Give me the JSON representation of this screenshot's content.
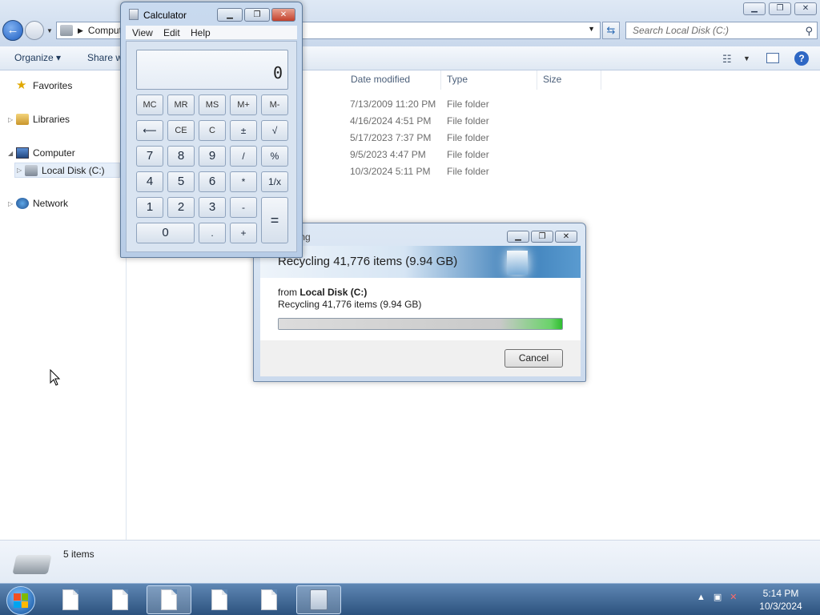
{
  "explorer": {
    "address": {
      "crumb": "Computer"
    },
    "search_placeholder": "Search Local Disk (C:)",
    "toolbar": {
      "organize": "Organize",
      "share": "Share with"
    },
    "nav": {
      "favorites": "Favorites",
      "libraries": "Libraries",
      "computer": "Computer",
      "local_disk": "Local Disk (C:)",
      "network": "Network"
    },
    "columns": {
      "date_modified": "Date modified",
      "type": "Type",
      "size": "Size"
    },
    "rows": [
      {
        "date": "7/13/2009 11:20 PM",
        "type": "File folder"
      },
      {
        "date": "4/16/2024 4:51 PM",
        "type": "File folder"
      },
      {
        "date": "5/17/2023 7:37 PM",
        "type": "File folder"
      },
      {
        "date": "9/5/2023 4:47 PM",
        "type": "File folder"
      },
      {
        "date": "10/3/2024 5:11 PM",
        "type": "File folder"
      }
    ],
    "status": "5 items"
  },
  "calculator": {
    "title": "Calculator",
    "menu": [
      "View",
      "Edit",
      "Help"
    ],
    "display": "0",
    "keys": {
      "mc": "MC",
      "mr": "MR",
      "ms": "MS",
      "mplus": "M+",
      "mminus": "M-",
      "back": "⟵",
      "ce": "CE",
      "c": "C",
      "plusminus": "±",
      "sqrt": "√",
      "k7": "7",
      "k8": "8",
      "k9": "9",
      "div": "/",
      "pct": "%",
      "k4": "4",
      "k5": "5",
      "k6": "6",
      "mul": "*",
      "recip": "1/x",
      "k1": "1",
      "k2": "2",
      "k3": "3",
      "sub": "-",
      "eq": "=",
      "k0": "0",
      "dot": ".",
      "add": "+"
    }
  },
  "dialog": {
    "title": "ling",
    "heading": "Recycling 41,776 items (9.94 GB)",
    "from_label": "from",
    "from_location": "Local Disk (C:)",
    "detail": "Recycling 41,776 items (9.94 GB)",
    "progress_percent": 100,
    "cancel": "Cancel"
  },
  "taskbar": {
    "time": "5:14 PM",
    "date": "10/3/2024"
  },
  "colors": {
    "taskbar": "#3b6594",
    "progress_green": "#2fbd2f",
    "close_red": "#c3412c"
  }
}
